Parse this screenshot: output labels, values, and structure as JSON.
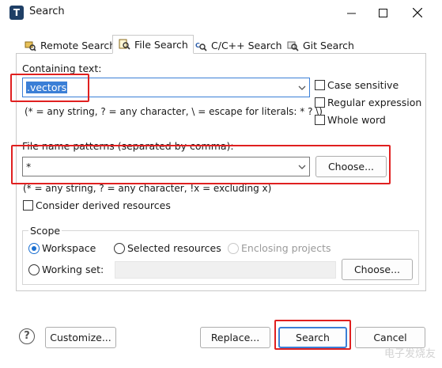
{
  "window": {
    "title": "Search",
    "app_icon_letter": "T"
  },
  "tabs": [
    {
      "label": "Remote Search",
      "active": false
    },
    {
      "label": "File Search",
      "active": true
    },
    {
      "label": "C/C++ Search",
      "active": false
    },
    {
      "label": "Git Search",
      "active": false
    }
  ],
  "containing_text": {
    "label": "Containing text:",
    "value": ".vectors",
    "hint": "(* = any string, ? = any character, \\ = escape for literals: * ? \\)"
  },
  "options": {
    "case_sensitive": {
      "label": "Case sensitive",
      "checked": false
    },
    "regular_expression": {
      "label": "Regular expression",
      "checked": false
    },
    "whole_word": {
      "label": "Whole word",
      "checked": false
    }
  },
  "file_patterns": {
    "label": "File name patterns (separated by comma):",
    "value": "*",
    "choose_label": "Choose...",
    "hint": "(* = any string, ? = any character, !x = excluding x)"
  },
  "derived": {
    "label": "Consider derived resources",
    "checked": false
  },
  "scope": {
    "title": "Scope",
    "workspace": {
      "label": "Workspace",
      "selected": true
    },
    "selected_resources": {
      "label": "Selected resources",
      "selected": false
    },
    "enclosing_projects": {
      "label": "Enclosing projects",
      "enabled": false
    },
    "working_set": {
      "label": "Working set:",
      "selected": false,
      "value": ""
    },
    "choose_label": "Choose..."
  },
  "footer": {
    "help": "?",
    "customize_label": "Customize...",
    "replace_label": "Replace...",
    "search_label": "Search",
    "cancel_label": "Cancel"
  },
  "watermark": "电子发烧友"
}
